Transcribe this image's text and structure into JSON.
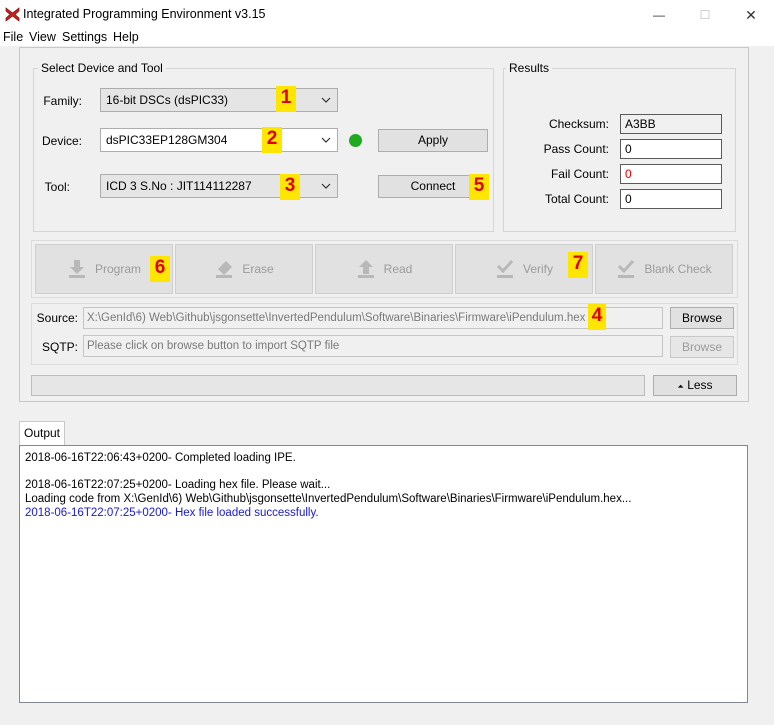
{
  "window": {
    "title": "Integrated Programming Environment v3.15",
    "min_glyph": "—",
    "max_glyph": "☐",
    "close_glyph": "✕"
  },
  "menu": [
    "File",
    "View",
    "Settings",
    "Help"
  ],
  "device_group": {
    "title": "Select Device and Tool",
    "family_label": "Family:",
    "family_value": "16-bit DSCs (dsPIC33)",
    "device_label": "Device:",
    "device_value": "dsPIC33EP128GM304",
    "tool_label": "Tool:",
    "tool_value": "ICD 3 S.No : JIT114112287",
    "status_color": "#1faa1f",
    "apply_label": "Apply",
    "connect_label": "Connect"
  },
  "results": {
    "title": "Results",
    "checksum_label": "Checksum:",
    "checksum_value": "A3BB",
    "pass_label": "Pass Count:",
    "pass_value": "0",
    "fail_label": "Fail Count:",
    "fail_value": "0",
    "total_label": "Total Count:",
    "total_value": "0"
  },
  "actions": {
    "program": "Program",
    "erase": "Erase",
    "read": "Read",
    "verify": "Verify",
    "blank_check": "Blank Check"
  },
  "source": {
    "label": "Source:",
    "value": "X:\\GenId\\6) Web\\Github\\jsgonsette\\InvertedPendulum\\Software\\Binaries\\Firmware\\iPendulum.hex",
    "browse_label": "Browse"
  },
  "sqtp": {
    "label": "SQTP:",
    "value": "Please click on browse button to import SQTP file",
    "browse_label": "Browse"
  },
  "less_label": "Less",
  "less_glyph": "⏶",
  "annotations": [
    "1",
    "2",
    "3",
    "4",
    "5",
    "6",
    "7"
  ],
  "output": {
    "tab_label": "Output",
    "lines": [
      "2018-06-16T22:06:43+0200- Completed loading IPE.",
      "2018-06-16T22:07:25+0200- Loading hex file. Please wait...",
      "Loading code from X:\\GenId\\6) Web\\Github\\jsgonsette\\InvertedPendulum\\Software\\Binaries\\Firmware\\iPendulum.hex...",
      "2018-06-16T22:07:25+0200- Hex file loaded successfully."
    ],
    "success_color": "#1a1acc"
  }
}
